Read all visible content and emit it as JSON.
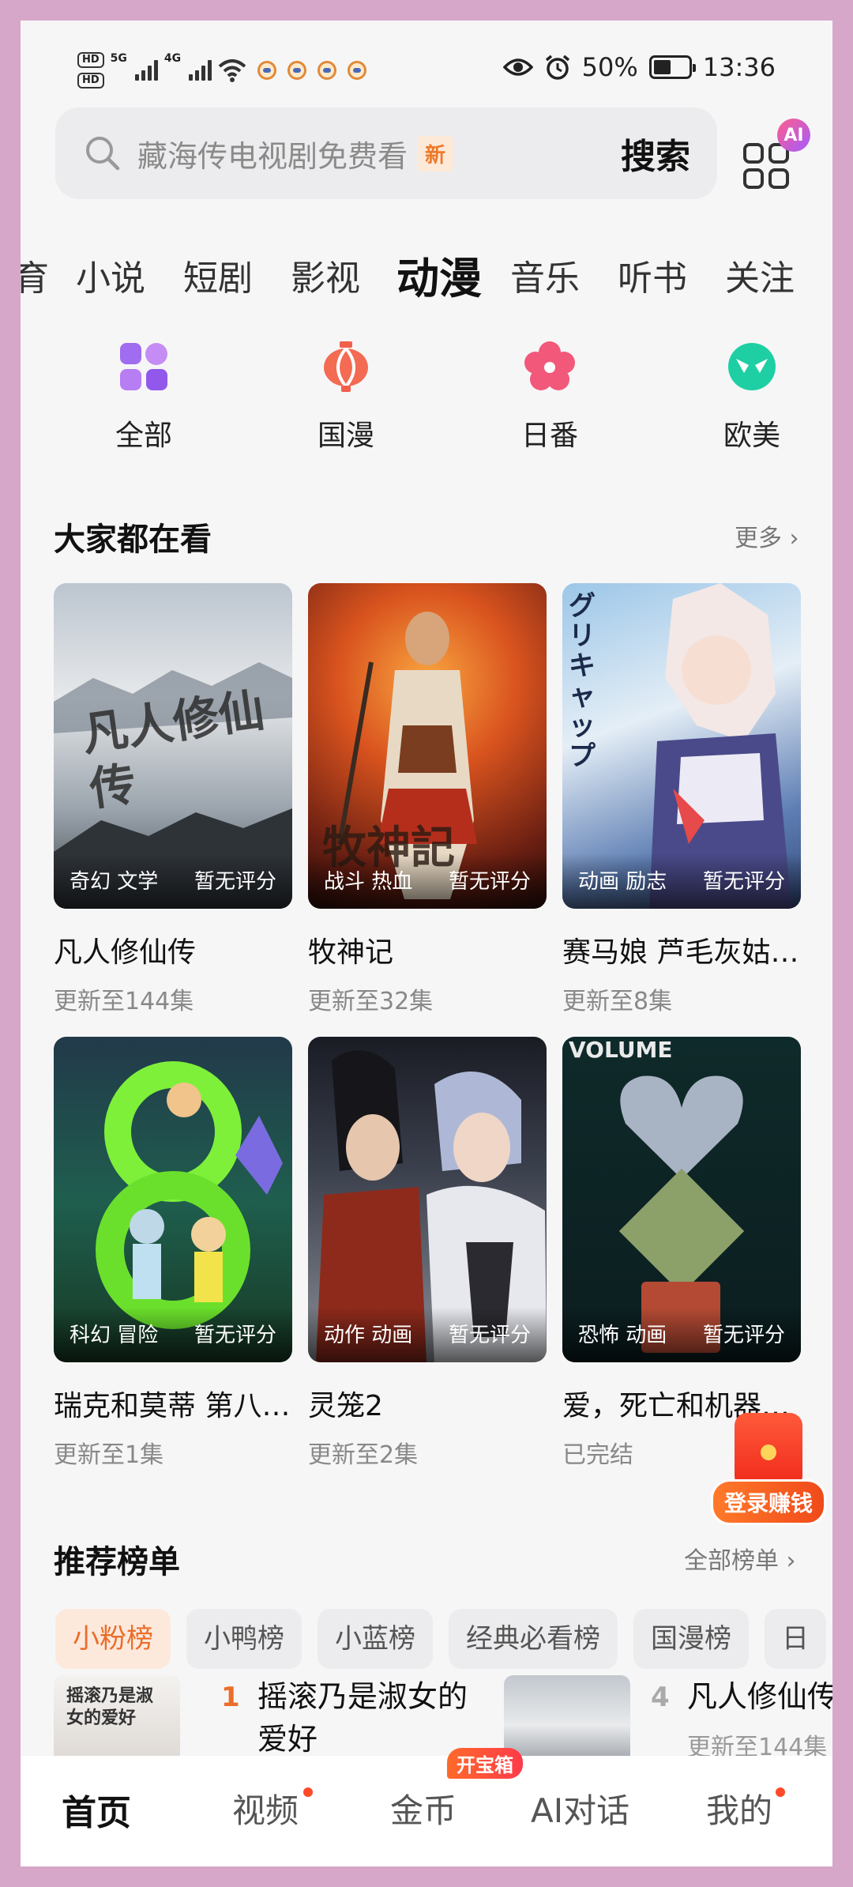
{
  "status_bar": {
    "hd1": "HD",
    "hd2": "HD",
    "net1": "5G",
    "net2": "4G",
    "battery": "50%",
    "battery_level": 0.5,
    "time": "13:36"
  },
  "search": {
    "placeholder": "藏海传电视剧免费看",
    "badge": "新",
    "button": "搜索",
    "ai_badge": "AI"
  },
  "tabs": [
    "育",
    "小说",
    "短剧",
    "影视",
    "动漫",
    "音乐",
    "听书",
    "关注"
  ],
  "active_tab": "动漫",
  "categories": [
    {
      "label": "全部",
      "icon": "grid-icon"
    },
    {
      "label": "国漫",
      "icon": "lantern-icon"
    },
    {
      "label": "日番",
      "icon": "sakura-icon"
    },
    {
      "label": "欧美",
      "icon": "mask-icon"
    }
  ],
  "popular": {
    "title": "大家都在看",
    "more": "更多",
    "items": [
      {
        "title": "凡人修仙传",
        "tags": "奇幻 文学",
        "score": "暂无评分",
        "update": "更新至144集"
      },
      {
        "title": "牧神记",
        "tags": "战斗 热血",
        "score": "暂无评分",
        "update": "更新至32集"
      },
      {
        "title": "赛马娘 芦毛灰姑…",
        "tags": "动画 励志",
        "score": "暂无评分",
        "update": "更新至8集"
      },
      {
        "title": "瑞克和莫蒂 第八…",
        "tags": "科幻 冒险",
        "score": "暂无评分",
        "update": "更新至1集"
      },
      {
        "title": "灵笼2",
        "tags": "动作 动画",
        "score": "暂无评分",
        "update": "更新至2集"
      },
      {
        "title": "爱，死亡和机器…",
        "tags": "恐怖 动画",
        "score": "暂无评分",
        "update": "已完结"
      }
    ]
  },
  "poster_text": {
    "p1": "凡人修仙传",
    "p2": "牧神記",
    "p3": "グリキャップ",
    "p6": "VOLUME"
  },
  "float_login": "登录赚钱",
  "ranking": {
    "title": "推荐榜单",
    "more": "全部榜单",
    "chips": [
      "小粉榜",
      "小鸭榜",
      "小蓝榜",
      "经典必看榜",
      "国漫榜",
      "日"
    ],
    "items": [
      {
        "rank": "1",
        "title_line1": "摇滚乃是淑女的",
        "title_line2": "爱好",
        "thumb_text": "摇滚乃是淑女的爱好"
      },
      {
        "rank": "4",
        "title_line1": "凡人修仙传",
        "sub": "更新至144集"
      }
    ]
  },
  "bottom_nav": {
    "home": "首页",
    "video": "视频",
    "coins": "金币",
    "coins_badge": "开宝箱",
    "ai_chat": "AI对话",
    "mine": "我的"
  },
  "colors": {
    "accent_orange": "#ea6d2a",
    "notify_red": "#ff4a2a"
  }
}
